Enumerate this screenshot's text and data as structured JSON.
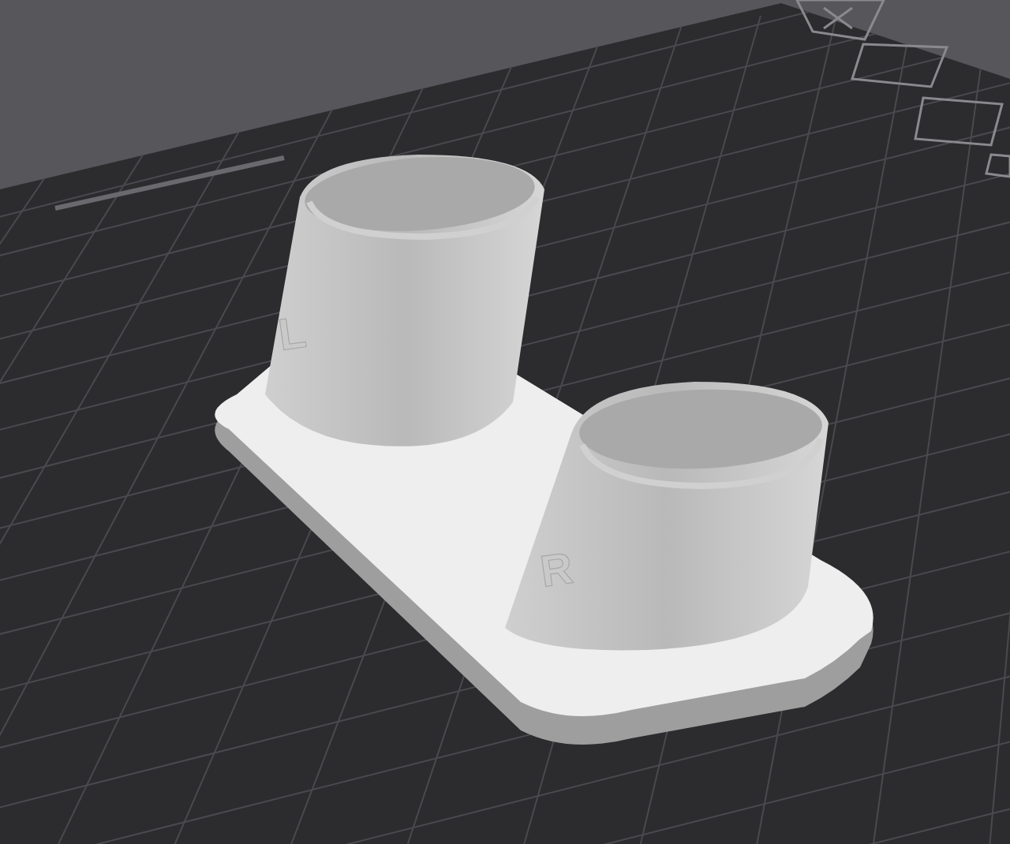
{
  "model": {
    "letters": [
      {
        "text": "L"
      },
      {
        "text": "R"
      }
    ]
  }
}
